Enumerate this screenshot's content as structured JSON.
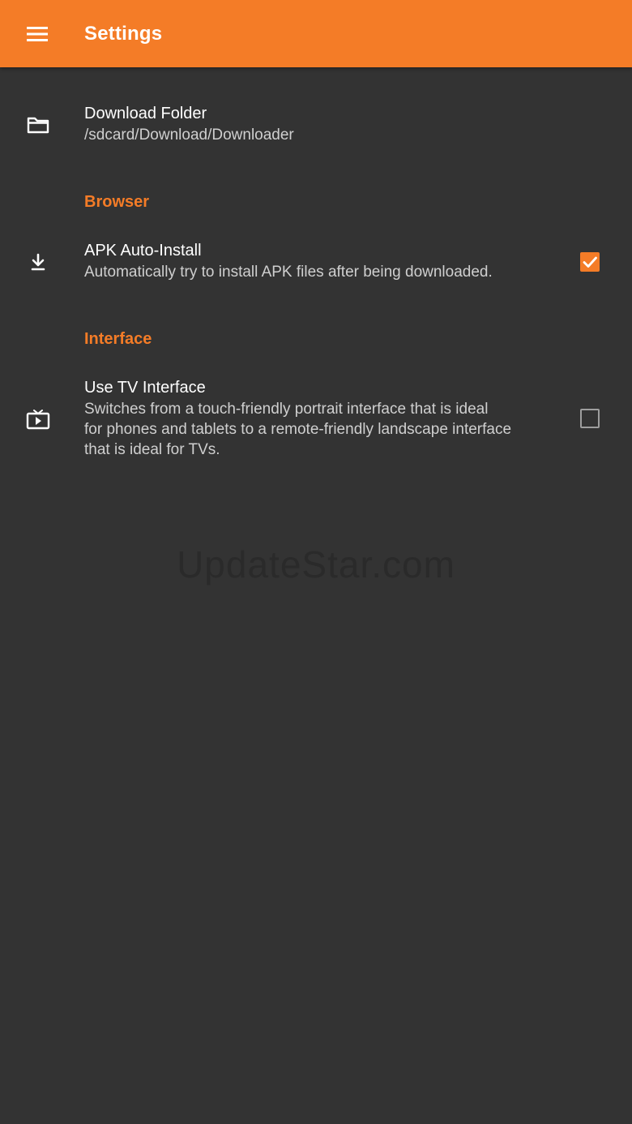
{
  "app_bar": {
    "title": "Settings",
    "menu_icon": "hamburger-menu-icon",
    "background": "#f47c27"
  },
  "preferences": {
    "download_folder": {
      "icon": "folder-icon",
      "title": "Download Folder",
      "summary": "/sdcard/Download/Downloader"
    },
    "browser_category": "Browser",
    "apk_auto_install": {
      "icon": "download-icon",
      "title": "APK Auto-Install",
      "summary": "Automatically try to install APK files after being downloaded.",
      "checked": true
    },
    "interface_category": "Interface",
    "tv_interface": {
      "icon": "tv-icon",
      "title": "Use TV Interface",
      "summary_lines": [
        "Switches from a touch-friendly portrait interface that is ideal",
        "for phones and tablets to a remote-friendly landscape interface",
        "that is ideal for TVs."
      ],
      "checked": false
    }
  },
  "watermark": "UpdateStar.com",
  "colors": {
    "accent": "#f47c27",
    "background": "#333333",
    "primary_text": "#ffffff",
    "secondary_text": "#cfcfcf"
  }
}
